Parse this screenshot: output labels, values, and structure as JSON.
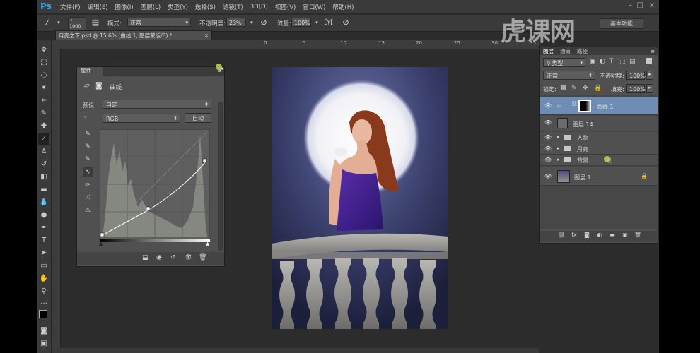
{
  "app": {
    "logo": "Ps",
    "menu": [
      "文件(F)",
      "编辑(E)",
      "图像(I)",
      "图层(L)",
      "类型(Y)",
      "选择(S)",
      "滤镜(T)",
      "3D(D)",
      "视图(V)",
      "窗口(W)",
      "帮助(H)"
    ]
  },
  "options": {
    "brush_size": "1000",
    "mode_label": "模式:",
    "mode_value": "正常",
    "opacity_label": "不透明度:",
    "opacity_value": "23%",
    "flow_label": "流量:",
    "flow_value": "100%",
    "workspace": "基本功能"
  },
  "document": {
    "tab_title": "月亮之下.psd @ 15.6% (曲线 1, 图层蒙版/8) *",
    "tab_close": "×"
  },
  "ruler": {
    "labels": [
      "0",
      "5",
      "10",
      "15",
      "20",
      "25",
      "30",
      "35"
    ]
  },
  "properties": {
    "tab": "属性",
    "type_label": "曲线",
    "preset_label": "预设:",
    "preset_value": "自定",
    "channel_value": "RGB",
    "auto_button": "自动"
  },
  "layers": {
    "tabs": [
      "图层",
      "通道",
      "路径"
    ],
    "filter_value": "类型",
    "blend_value": "正常",
    "opacity_label": "不透明度:",
    "opacity_value": "100%",
    "lock_label": "锁定:",
    "fill_label": "填充:",
    "fill_value": "100%",
    "items": [
      {
        "name": "曲线 1"
      },
      {
        "name": "图层 14"
      },
      {
        "name": "人物"
      },
      {
        "name": "月亮"
      },
      {
        "name": "背景"
      },
      {
        "name": "图层 1"
      }
    ]
  },
  "watermark": "虎课网",
  "colors": {
    "selected_layer": "#6f8db4",
    "ps_blue": "#3aa6e8"
  }
}
